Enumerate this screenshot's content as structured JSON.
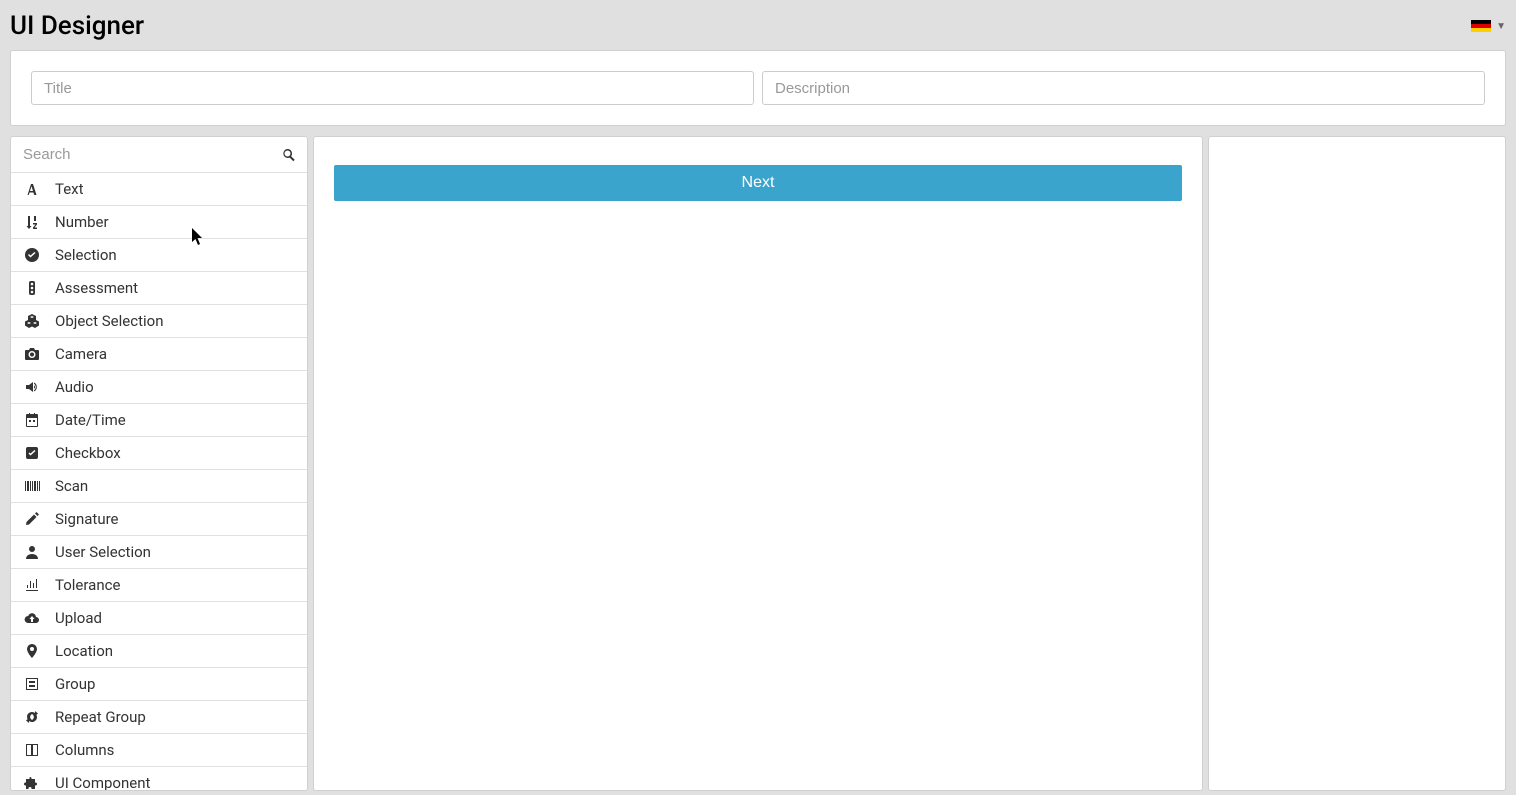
{
  "header": {
    "title": "UI Designer",
    "language": "de"
  },
  "form": {
    "title_placeholder": "Title",
    "title_value": "",
    "description_placeholder": "Description",
    "description_value": ""
  },
  "sidebar": {
    "search_placeholder": "Search",
    "search_value": "",
    "items": [
      {
        "icon": "font",
        "label": "Text"
      },
      {
        "icon": "sort-numeric",
        "label": "Number"
      },
      {
        "icon": "check-circle",
        "label": "Selection"
      },
      {
        "icon": "traffic-light",
        "label": "Assessment"
      },
      {
        "icon": "cubes",
        "label": "Object Selection"
      },
      {
        "icon": "camera",
        "label": "Camera"
      },
      {
        "icon": "volume",
        "label": "Audio"
      },
      {
        "icon": "calendar",
        "label": "Date/Time"
      },
      {
        "icon": "check-square",
        "label": "Checkbox"
      },
      {
        "icon": "barcode",
        "label": "Scan"
      },
      {
        "icon": "pencil",
        "label": "Signature"
      },
      {
        "icon": "user",
        "label": "User Selection"
      },
      {
        "icon": "tolerance",
        "label": "Tolerance"
      },
      {
        "icon": "cloud-upload",
        "label": "Upload"
      },
      {
        "icon": "map-marker",
        "label": "Location"
      },
      {
        "icon": "group-box",
        "label": "Group"
      },
      {
        "icon": "repeat",
        "label": "Repeat Group"
      },
      {
        "icon": "columns",
        "label": "Columns"
      },
      {
        "icon": "puzzle",
        "label": "UI Component"
      }
    ]
  },
  "canvas": {
    "next_label": "Next"
  }
}
